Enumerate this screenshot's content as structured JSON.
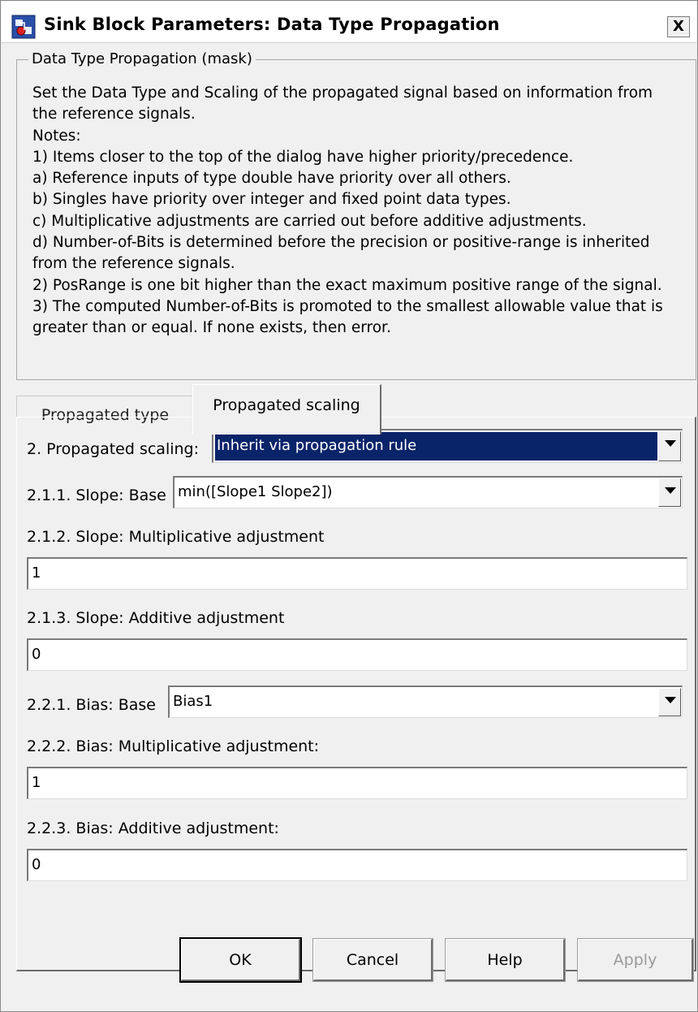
{
  "window": {
    "title": "Sink Block Parameters: Data Type Propagation",
    "close_label": "X"
  },
  "mask": {
    "title": "Data Type Propagation (mask)",
    "description_lines": [
      "Set the Data Type and Scaling of the propagated signal based on information from",
      "the reference signals.",
      "Notes:",
      "1) Items closer to the top of the dialog have higher priority/precedence.",
      "a) Reference inputs of type double have priority over all others.",
      "b) Singles have priority over integer and fixed point data types.",
      "c) Multiplicative adjustments are carried out before additive adjustments.",
      "d) Number-of-Bits is determined before the precision or positive-range is inherited",
      "from the reference signals.",
      "2) PosRange is one bit higher than the exact maximum positive range of the signal.",
      "3) The computed Number-of-Bits is promoted to the smallest allowable value that is",
      "greater than or equal.  If none exists, then error."
    ]
  },
  "tabs": [
    {
      "label": "Propagated type",
      "active": false
    },
    {
      "label": "Propagated scaling",
      "active": true
    }
  ],
  "params": {
    "propagated_scaling": {
      "label": "2. Propagated scaling:",
      "value": "Inherit via propagation rule"
    },
    "slope_base": {
      "label": "2.1.1. Slope: Base",
      "value": "min([Slope1 Slope2])"
    },
    "slope_mult": {
      "label": "2.1.2. Slope: Multiplicative adjustment",
      "value": "1"
    },
    "slope_add": {
      "label": "2.1.3. Slope: Additive adjustment",
      "value": "0"
    },
    "bias_base": {
      "label": "2.2.1. Bias: Base",
      "value": "Bias1"
    },
    "bias_mult": {
      "label": "2.2.2. Bias: Multiplicative adjustment:",
      "value": "1"
    },
    "bias_add": {
      "label": "2.2.3. Bias: Additive adjustment:",
      "value": "0"
    }
  },
  "buttons": {
    "ok": "OK",
    "cancel": "Cancel",
    "help": "Help",
    "apply": "Apply"
  },
  "colors": {
    "selection": "#0a246a",
    "dialog_bg": "#f0f0f0"
  },
  "icons": {
    "app": "simulink-block-icon",
    "close": "close-icon",
    "dropdown": "chevron-down-icon"
  }
}
